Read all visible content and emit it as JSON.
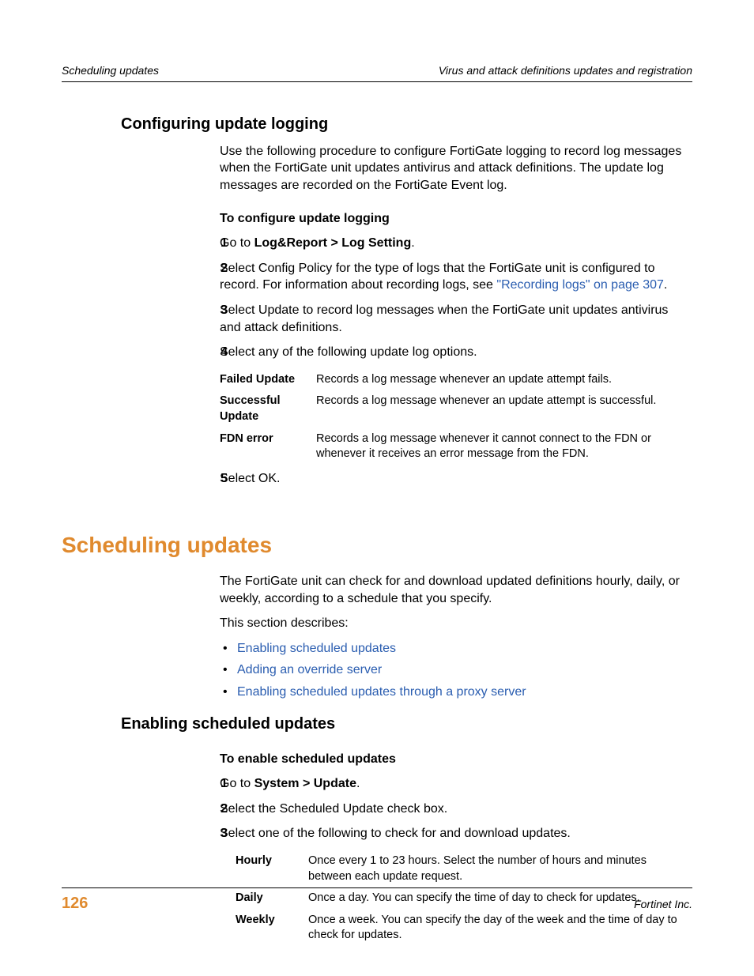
{
  "header": {
    "left": "Scheduling updates",
    "right": "Virus and attack definitions updates and registration"
  },
  "section1": {
    "title": "Configuring update logging",
    "intro": "Use the following procedure to configure FortiGate logging to record log messages when the FortiGate unit updates antivirus and attack definitions. The update log messages are recorded on the FortiGate Event log.",
    "proc_title": "To configure update logging",
    "steps": {
      "n1": "1",
      "t1a": "Go to ",
      "t1b": "Log&Report > Log Setting",
      "t1c": ".",
      "n2": "2",
      "t2a": "Select Config Policy for the type of logs that the FortiGate unit is configured to record. For information about recording logs, see ",
      "t2link": "\"Recording logs\" on page 307",
      "t2b": ".",
      "n3": "3",
      "t3": "Select Update to record log messages when the FortiGate unit updates antivirus and attack definitions.",
      "n4": "4",
      "t4": "Select any of the following update log options.",
      "n5": "5",
      "t5": "Select OK."
    },
    "deftable": {
      "r1": {
        "term": "Failed Update",
        "desc": "Records a log message whenever an update attempt fails."
      },
      "r2": {
        "term": "Successful Update",
        "desc": "Records a log message whenever an update attempt is successful."
      },
      "r3": {
        "term": "FDN error",
        "desc": "Records a log message whenever it cannot connect to the FDN or whenever it receives an error message from the FDN."
      }
    }
  },
  "section2": {
    "title": "Scheduling updates",
    "intro1": "The FortiGate unit can check for and download updated definitions hourly, daily, or weekly, according to a schedule that you specify.",
    "intro2": "This section describes:",
    "bullets": {
      "b1": "Enabling scheduled updates",
      "b2": "Adding an override server",
      "b3": "Enabling scheduled updates through a proxy server"
    }
  },
  "section3": {
    "title": "Enabling scheduled updates",
    "proc_title": "To enable scheduled updates",
    "steps": {
      "n1": "1",
      "t1a": "Go to ",
      "t1b": "System > Update",
      "t1c": ".",
      "n2": "2",
      "t2": "Select the Scheduled Update check box.",
      "n3": "3",
      "t3": "Select one of the following to check for and download updates."
    },
    "deftable": {
      "r1": {
        "term": "Hourly",
        "desc": "Once every 1 to 23 hours. Select the number of hours and minutes between each update request."
      },
      "r2": {
        "term": "Daily",
        "desc": "Once a day. You can specify the time of day to check for updates."
      },
      "r3": {
        "term": "Weekly",
        "desc": "Once a week. You can specify the day of the week and the time of day to check for updates."
      }
    }
  },
  "footer": {
    "page": "126",
    "right": "Fortinet Inc."
  }
}
